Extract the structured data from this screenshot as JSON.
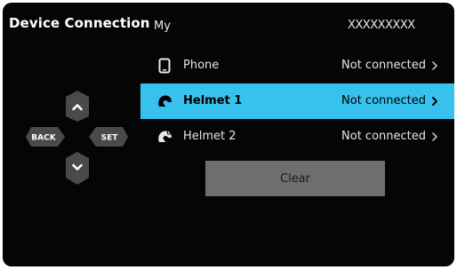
{
  "header": {
    "title": "Device Connection",
    "my_label": "My",
    "device_id": "XXXXXXXXX"
  },
  "devices": [
    {
      "label": "Phone",
      "status": "Not connected",
      "icon": "phone-icon",
      "selected": false
    },
    {
      "label": "Helmet 1",
      "status": "Not connected",
      "icon": "helmet-1-icon",
      "selected": true
    },
    {
      "label": "Helmet 2",
      "status": "Not connected",
      "icon": "helmet-2-icon",
      "selected": false
    }
  ],
  "clear_button": {
    "label": "Clear"
  },
  "dpad": {
    "up_icon": "chevron-up-icon",
    "down_icon": "chevron-down-icon",
    "back_label": "BACK",
    "set_label": "SET"
  },
  "colors": {
    "screen_background": "#050505",
    "selection": "#37c2ee",
    "button_gray": "#6e6e6e",
    "dpad_gray": "#4a4a4a",
    "text": "#e6e6e6"
  }
}
